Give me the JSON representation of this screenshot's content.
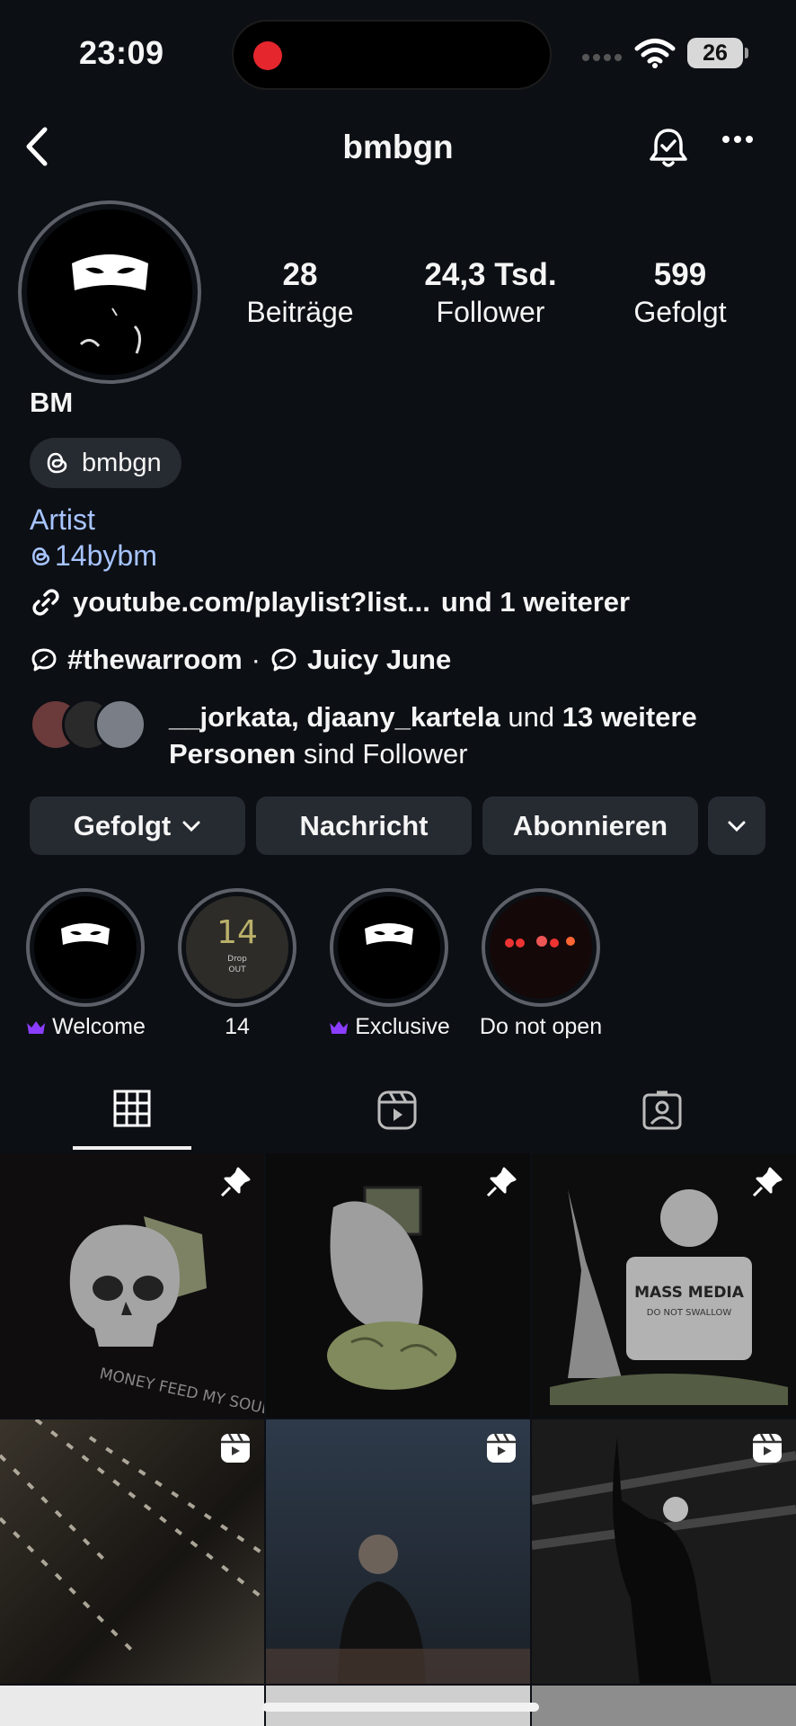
{
  "status_bar": {
    "time": "23:09",
    "battery": "26"
  },
  "header": {
    "username": "bmbgn"
  },
  "stats": [
    {
      "count": "28",
      "label": "Beiträge"
    },
    {
      "count": "24,3 Tsd.",
      "label": "Follower"
    },
    {
      "count": "599",
      "label": "Gefolgt"
    }
  ],
  "profile": {
    "name": "BM",
    "threads_handle": "bmbgn",
    "category": "Artist",
    "mention": "14bybm",
    "link_text": "youtube.com/playlist?list...",
    "link_more": "und 1 weiterer",
    "tag_1": "#thewarroom",
    "tag_separator": "·",
    "tag_2": "Juicy June",
    "followed_by_names": "__jorkata, djaany_kartela",
    "followed_by_and": "und",
    "followed_by_count": "13 weitere Personen",
    "followed_by_suffix": "sind Follower"
  },
  "buttons": {
    "following": "Gefolgt",
    "message": "Nachricht",
    "subscribe": "Abonnieren"
  },
  "highlights": [
    {
      "label": "Welcome",
      "exclusive": true
    },
    {
      "label": "14",
      "exclusive": false
    },
    {
      "label": "Exclusive",
      "exclusive": true
    },
    {
      "label": "Do not open",
      "exclusive": false
    }
  ],
  "highlight_14_text": {
    "number": "14",
    "caption_1": "Drop",
    "caption_2": "OUT"
  },
  "posts": {
    "post_1_text": "MONEY FEED MY SOUL",
    "post_3_sign": "MASS MEDIA",
    "post_3_sub": "DO NOT SWALLOW"
  },
  "colors": {
    "background": "#0c0f14",
    "button_bg": "#262a31",
    "link_blue": "#a7c4ff",
    "record_red": "#e5262d",
    "crown_purple": "#8b3dff"
  },
  "icons": [
    "back-arrow-icon",
    "bell-check-icon",
    "more-icon",
    "threads-icon",
    "link-icon",
    "broadcast-icon",
    "chevron-down-icon",
    "crown-icon",
    "grid-icon",
    "reels-icon",
    "tagged-icon",
    "pin-icon",
    "reel-badge-icon"
  ]
}
